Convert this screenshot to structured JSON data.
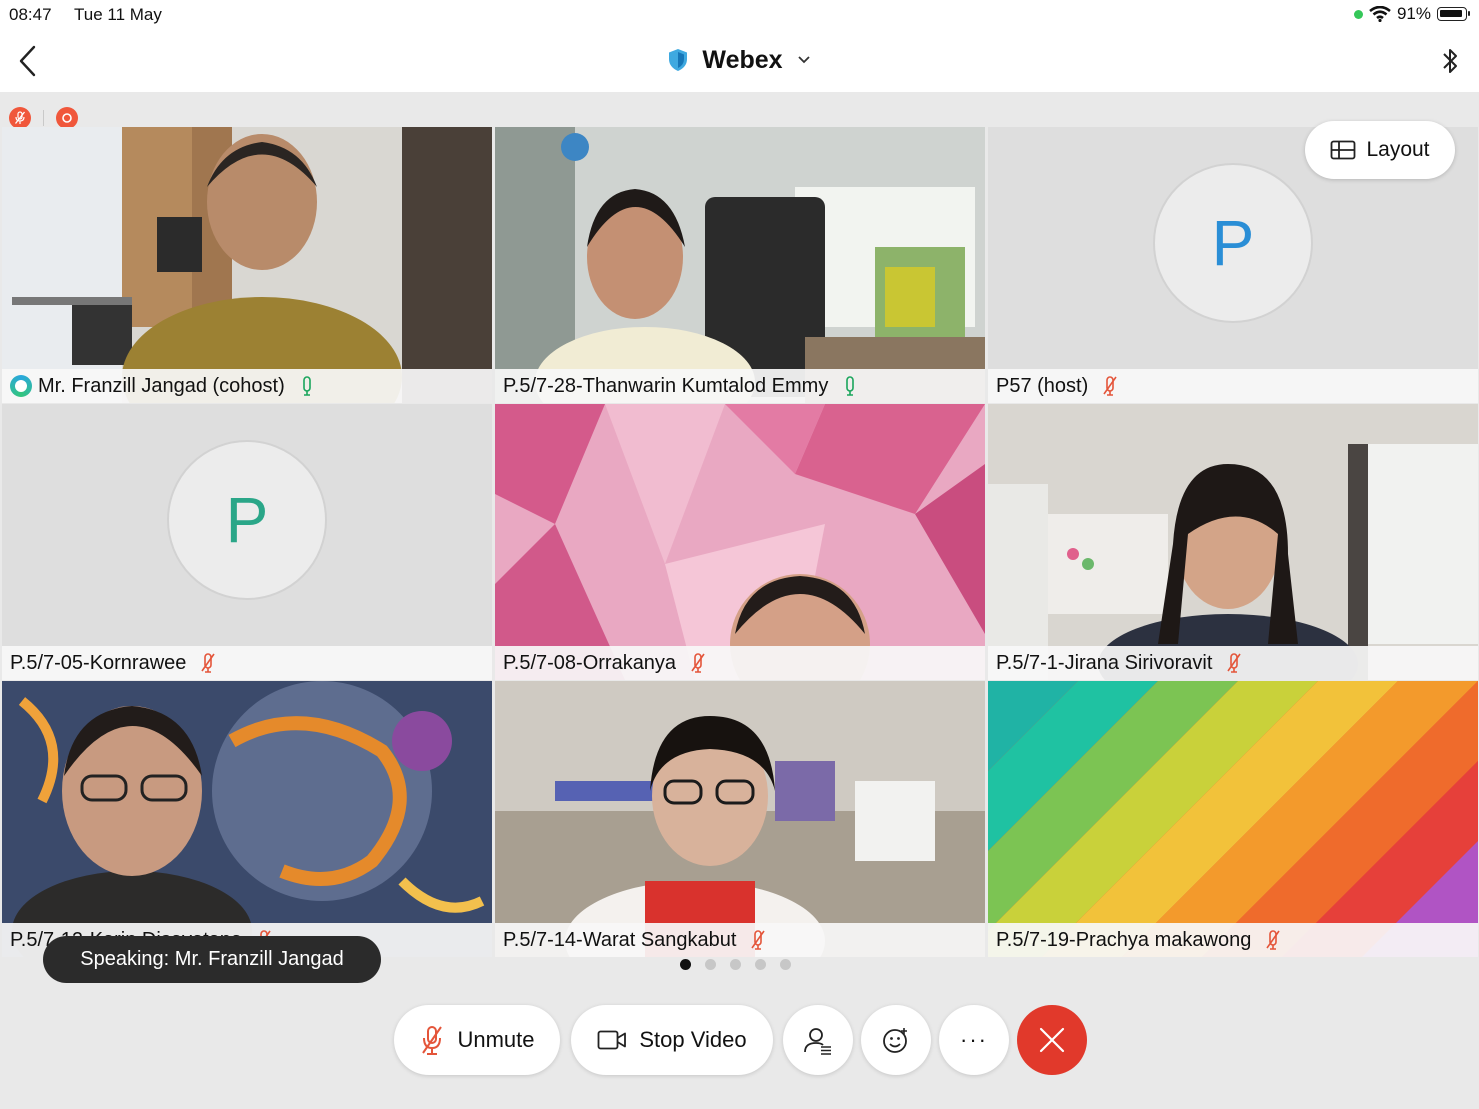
{
  "status_bar": {
    "time": "08:47",
    "date": "Tue 11 May",
    "battery": "91%"
  },
  "header": {
    "title": "Webex"
  },
  "layout_button": {
    "label": "Layout"
  },
  "participants": [
    {
      "name": "Mr. Franzill Jangad (cohost)",
      "mic": "on",
      "video": true
    },
    {
      "name": "P.5/7-28-Thanwarin Kumtalod Emmy",
      "mic": "on",
      "video": true,
      "active": true
    },
    {
      "name": "P57 (host)",
      "mic": "muted",
      "video": false,
      "avatar_letter": "P"
    },
    {
      "name": "P.5/7-05-Kornrawee",
      "mic": "muted",
      "video": false,
      "avatar_letter": "P"
    },
    {
      "name": "P.5/7-08-Orrakanya",
      "mic": "muted",
      "video": true
    },
    {
      "name": "P.5/7-1-Jirana Sirivoravit",
      "mic": "muted",
      "video": true
    },
    {
      "name": "P.5/7-12-Karin Disavatana",
      "mic": "muted",
      "video": true
    },
    {
      "name": "P.5/7-14-Warat Sangkabut",
      "mic": "muted",
      "video": true
    },
    {
      "name": "P.5/7-19-Prachya makawong",
      "mic": "muted",
      "video": true
    }
  ],
  "speaking_toast": "Speaking: Mr. Franzill Jangad",
  "page_dots": {
    "count": 5,
    "current": 1
  },
  "controls": {
    "unmute_label": "Unmute",
    "stop_video_label": "Stop Video",
    "participants_icon": "participants-icon",
    "reactions_icon": "emoji-icon",
    "more_label": "···",
    "end_icon": "close-icon"
  },
  "colors": {
    "accent_blue": "#0b6fa8",
    "end_red": "#e1392b",
    "badge_red": "#f0573b",
    "mic_on": "#1aa55c",
    "mic_muted": "#e4553a"
  }
}
